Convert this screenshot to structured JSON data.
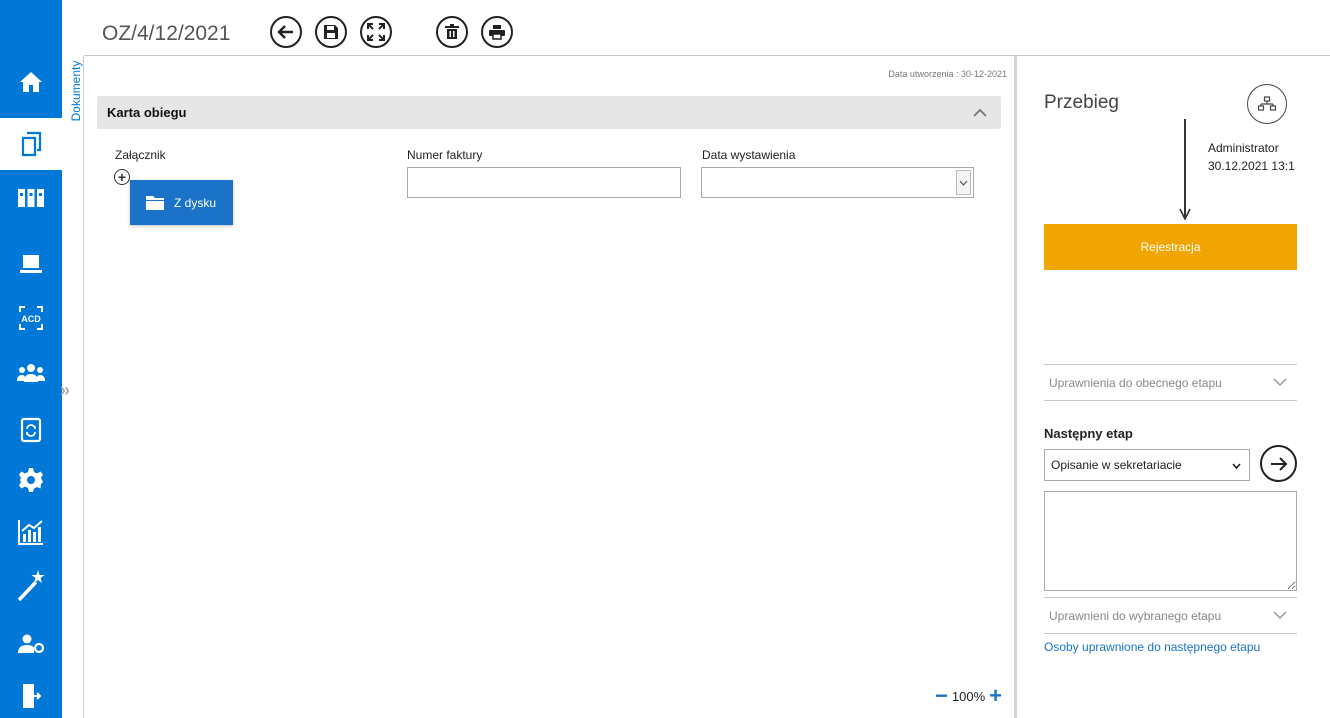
{
  "doc": {
    "title": "OZ/4/12/2021",
    "created": "Data utworzenia : 30-12-2021"
  },
  "toolbar": {
    "back": "back-icon",
    "save": "save-icon",
    "fullscreen": "fullscreen-icon",
    "delete": "delete-icon",
    "print": "print-icon"
  },
  "nav": {
    "items": [
      "home-icon",
      "documents-icon",
      "library-icon",
      "workstation-icon",
      "acd-icon",
      "users-icon",
      "document-sync-icon",
      "settings-icon",
      "reports-icon",
      "wizard-icon",
      "user-admin-icon",
      "logout-icon"
    ]
  },
  "sidebar": {
    "label": "Dokumenty"
  },
  "section": {
    "title": "Karta obiegu"
  },
  "form": {
    "attachment_label": "Załącznik",
    "from_disk": "Z dysku",
    "invoice_label": "Numer faktury",
    "invoice_value": "",
    "date_label": "Data wystawienia",
    "date_value": ""
  },
  "zoom": {
    "value": "100%",
    "minus": "−",
    "plus": "+"
  },
  "panel": {
    "title": "Przebieg",
    "actor_name": "Administrator",
    "actor_time": "30.12.2021 13:1",
    "stage": "Rejestracja",
    "current_perms": "Uprawnienia do obecnego etapu",
    "next_label": "Następny etap",
    "next_value": "Opisanie w sekretariacie",
    "next_perms": "Uprawnieni do wybranego etapu",
    "link": "Osoby uprawnione do następnego etapu"
  },
  "colors": {
    "nav_blue": "#0078d7",
    "stage_orange": "#f0a500",
    "button_blue": "#1a73c8"
  }
}
